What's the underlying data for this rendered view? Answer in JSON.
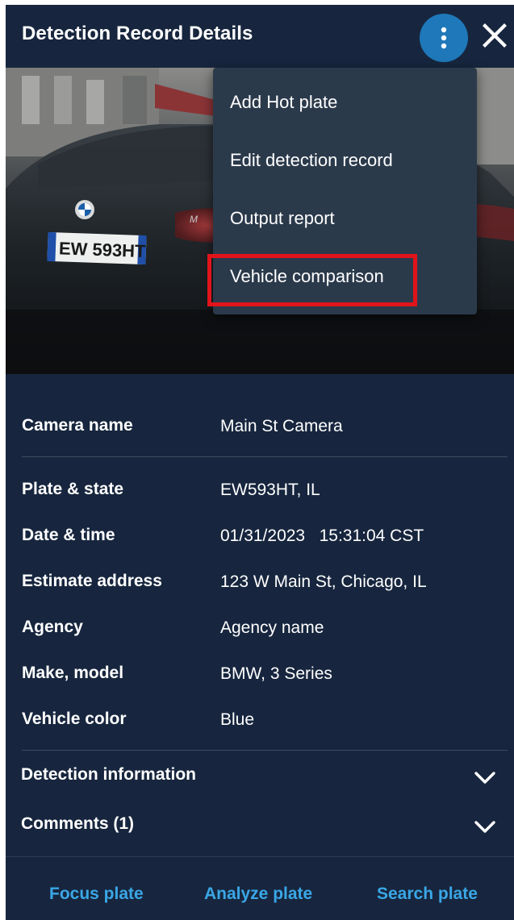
{
  "header": {
    "title": "Detection Record Details",
    "more_icon": "vertical-dots-icon",
    "close_icon": "close-icon"
  },
  "photo": {
    "plate_text": "EW 593HT",
    "description": ""
  },
  "menu": {
    "items": [
      {
        "label": "Add Hot plate"
      },
      {
        "label": "Edit detection record"
      },
      {
        "label": "Output report"
      },
      {
        "label": "Vehicle comparison"
      }
    ]
  },
  "details": {
    "camera": {
      "label": "Camera name",
      "value": "Main St Camera"
    },
    "plate": {
      "label": "Plate & state",
      "value": "EW593HT, IL"
    },
    "datetime": {
      "label": "Date & time",
      "value": "01/31/2023   15:31:04 CST"
    },
    "address": {
      "label": "Estimate address",
      "value": "123 W Main St, Chicago, IL"
    },
    "agency": {
      "label": "Agency",
      "value": "Agency name"
    },
    "make": {
      "label": "Make, model",
      "value": "BMW, 3 Series"
    },
    "color": {
      "label": "Vehicle color",
      "value": "Blue"
    }
  },
  "sections": {
    "detection_info": "Detection information",
    "comments": "Comments (1)"
  },
  "footer": {
    "focus": "Focus plate",
    "analyze": "Analyze plate",
    "search": "Search plate"
  },
  "colors": {
    "background": "#17263e",
    "menu": "#2b3a4b",
    "accent": "#1e78b9",
    "link": "#3aa7e6",
    "highlight": "#e1141b"
  }
}
